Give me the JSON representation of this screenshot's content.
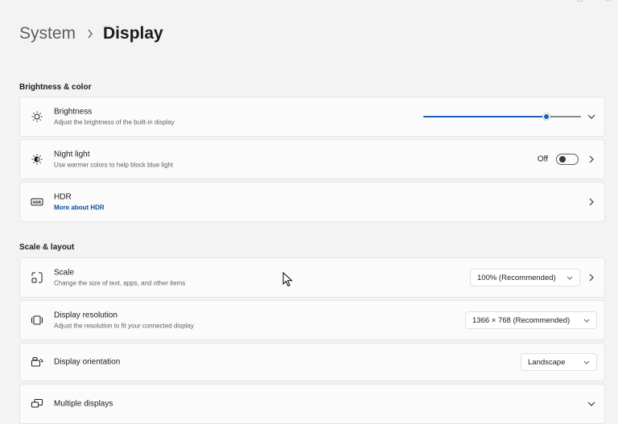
{
  "breadcrumb": {
    "parent": "System",
    "current": "Display"
  },
  "sections": {
    "brightness_color": "Brightness & color",
    "scale_layout": "Scale & layout"
  },
  "brightness": {
    "title": "Brightness",
    "desc": "Adjust the brightness of the built-in display",
    "level": 0.78,
    "icon": "sun-icon"
  },
  "night_light": {
    "title": "Night light",
    "desc": "Use warmer colors to help block blue light",
    "state": "Off",
    "icon": "night-light-icon"
  },
  "hdr": {
    "title": "HDR",
    "link": "More about HDR",
    "icon": "hdr-icon"
  },
  "scale": {
    "title": "Scale",
    "desc": "Change the size of text, apps, and other items",
    "value": "100% (Recommended)",
    "icon": "scale-icon"
  },
  "resolution": {
    "title": "Display resolution",
    "desc": "Adjust the resolution to fit your connected display",
    "value": "1366 × 768 (Recommended)",
    "icon": "resolution-icon"
  },
  "orientation": {
    "title": "Display orientation",
    "value": "Landscape",
    "icon": "orientation-icon"
  },
  "multiple": {
    "title": "Multiple displays",
    "icon": "multiple-displays-icon"
  },
  "colors": {
    "accent": "#1f5fb3",
    "link": "#0a4fa3"
  }
}
